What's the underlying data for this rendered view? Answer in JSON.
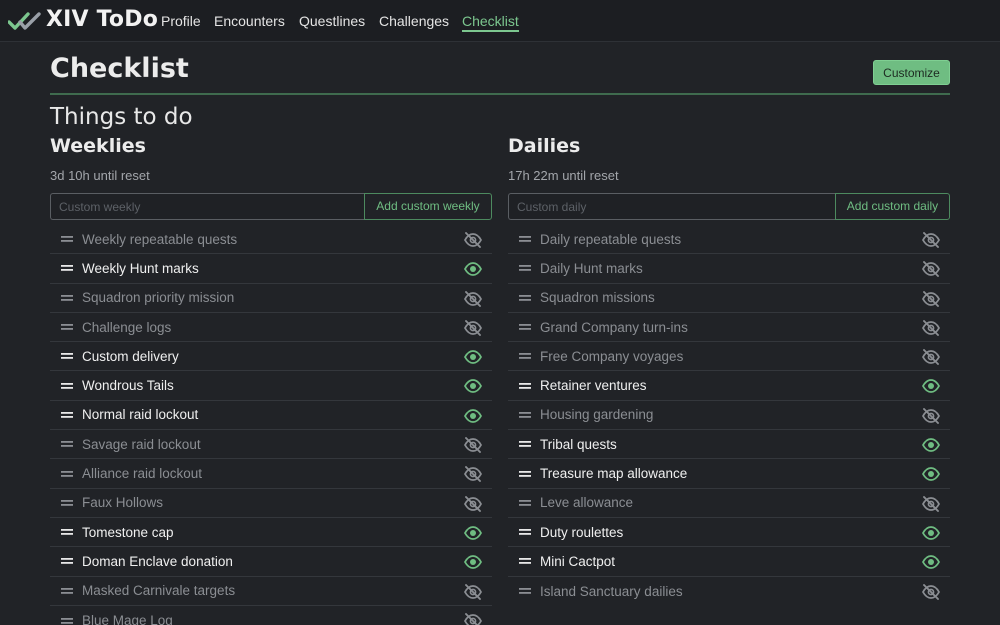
{
  "app": {
    "brand": "XIV ToDo",
    "nav": [
      {
        "label": "Profile",
        "active": false
      },
      {
        "label": "Encounters",
        "active": false
      },
      {
        "label": "Questlines",
        "active": false
      },
      {
        "label": "Challenges",
        "active": false
      },
      {
        "label": "Checklist",
        "active": true
      }
    ]
  },
  "page": {
    "title": "Checklist",
    "customize_label": "Customize",
    "section_heading": "Things to do"
  },
  "weeklies": {
    "title": "Weeklies",
    "reset_text": "3d 10h until reset",
    "input_placeholder": "Custom weekly",
    "input_value": "",
    "add_label": "Add custom weekly",
    "items": [
      {
        "label": "Weekly repeatable quests",
        "visible": false
      },
      {
        "label": "Weekly Hunt marks",
        "visible": true
      },
      {
        "label": "Squadron priority mission",
        "visible": false
      },
      {
        "label": "Challenge logs",
        "visible": false
      },
      {
        "label": "Custom delivery",
        "visible": true
      },
      {
        "label": "Wondrous Tails",
        "visible": true
      },
      {
        "label": "Normal raid lockout",
        "visible": true
      },
      {
        "label": "Savage raid lockout",
        "visible": false
      },
      {
        "label": "Alliance raid lockout",
        "visible": false
      },
      {
        "label": "Faux Hollows",
        "visible": false
      },
      {
        "label": "Tomestone cap",
        "visible": true
      },
      {
        "label": "Doman Enclave donation",
        "visible": true
      },
      {
        "label": "Masked Carnivale targets",
        "visible": false
      },
      {
        "label": "Blue Mage Log",
        "visible": false
      }
    ]
  },
  "dailies": {
    "title": "Dailies",
    "reset_text": "17h 22m until reset",
    "input_placeholder": "Custom daily",
    "input_value": "",
    "add_label": "Add custom daily",
    "items": [
      {
        "label": "Daily repeatable quests",
        "visible": false
      },
      {
        "label": "Daily Hunt marks",
        "visible": false
      },
      {
        "label": "Squadron missions",
        "visible": false
      },
      {
        "label": "Grand Company turn-ins",
        "visible": false
      },
      {
        "label": "Free Company voyages",
        "visible": false
      },
      {
        "label": "Retainer ventures",
        "visible": true
      },
      {
        "label": "Housing gardening",
        "visible": false
      },
      {
        "label": "Tribal quests",
        "visible": true
      },
      {
        "label": "Treasure map allowance",
        "visible": true
      },
      {
        "label": "Leve allowance",
        "visible": false
      },
      {
        "label": "Duty roulettes",
        "visible": true
      },
      {
        "label": "Mini Cactpot",
        "visible": true
      },
      {
        "label": "Island Sanctuary dailies",
        "visible": false
      }
    ]
  },
  "icons": {
    "logo": "double-check-logo-icon",
    "handle": "drag-handle-icon",
    "visible": "eye-icon",
    "hidden": "eye-slash-icon"
  },
  "colors": {
    "accent": "#6fbd82",
    "background": "#212327",
    "navbar": "#1c1e22",
    "muted_text": "#8b8e93"
  }
}
